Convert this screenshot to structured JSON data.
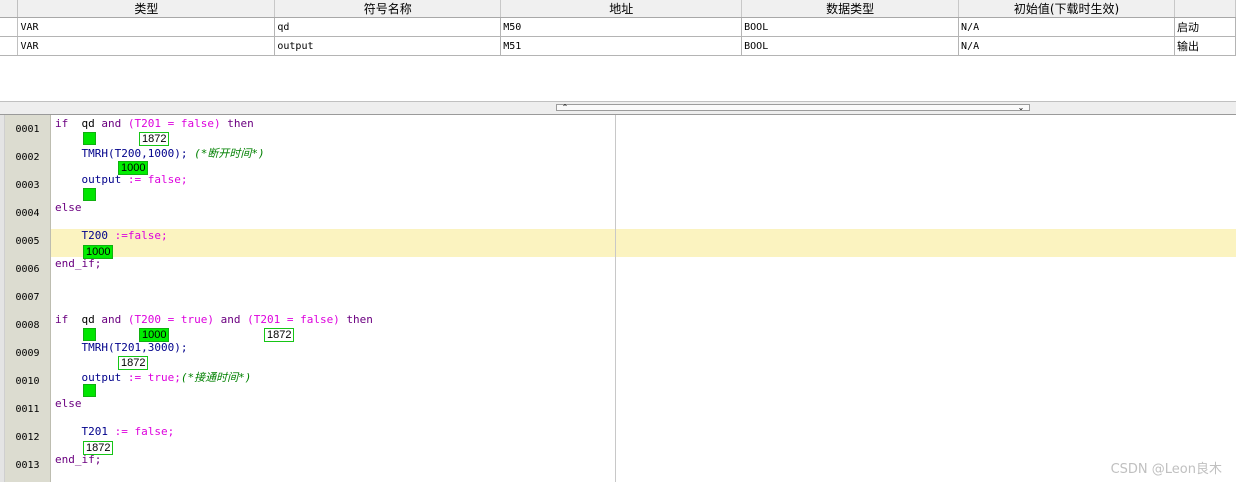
{
  "var_table": {
    "columns": [
      "类型",
      "符号名称",
      "地址",
      "数据类型",
      "初始值(下载时生效)",
      ""
    ],
    "rows": [
      [
        "VAR",
        "qd",
        "M50",
        "BOOL",
        "N/A",
        "启动"
      ],
      [
        "VAR",
        "output",
        "M51",
        "BOOL",
        "N/A",
        "输出"
      ]
    ]
  },
  "splitter": {
    "collapse_up": "⌃",
    "collapse_down": "⌄"
  },
  "line_numbers": [
    "0001",
    "0002",
    "0003",
    "0004",
    "0005",
    "0006",
    "0007",
    "0008",
    "0009",
    "0010",
    "0011",
    "0012",
    "0013"
  ],
  "code": {
    "l1": {
      "if": "if",
      "qd": "qd",
      "and": "and",
      "expr": "(T201 = false)",
      "then": "then"
    },
    "l2": {
      "fn": "TMRH",
      "args": "(T200,1000);",
      "comment": "(*断开时间*)"
    },
    "l3": {
      "var": "output",
      "assign": ":= false;"
    },
    "l4": {
      "else": "else"
    },
    "l5": {
      "var": "T200",
      "assign": ":=false;"
    },
    "l6": {
      "end": "end_if;"
    },
    "l8": {
      "if": "if",
      "qd": "qd",
      "and1": "and",
      "expr1": "(T200 = true)",
      "and2": "and",
      "expr2": "(T201 = false)",
      "then": "then"
    },
    "l9": {
      "fn": "TMRH",
      "args": "(T201,3000);"
    },
    "l10": {
      "var": "output",
      "assign": ":= true;",
      "comment": "(*接通时间*)"
    },
    "l11": {
      "else": "else"
    },
    "l12": {
      "var": "T201",
      "assign": ":= false;"
    },
    "l13": {
      "end": "end_if;"
    }
  },
  "monitor": {
    "l1_t201": "1872",
    "l2_t200": "1000",
    "l5_t200": "1000",
    "l8_t200": "1000",
    "l8_t201": "1872",
    "l9_t201": "1872",
    "l12_t201": "1872"
  },
  "watermark": "CSDN @Leon良木",
  "colors": {
    "keyword": "#6b0080",
    "function": "#00008b",
    "operator": "#dd00dd",
    "comment": "#008000",
    "monitor_on": "#00ee00",
    "current_line": "#fbf3c0"
  }
}
